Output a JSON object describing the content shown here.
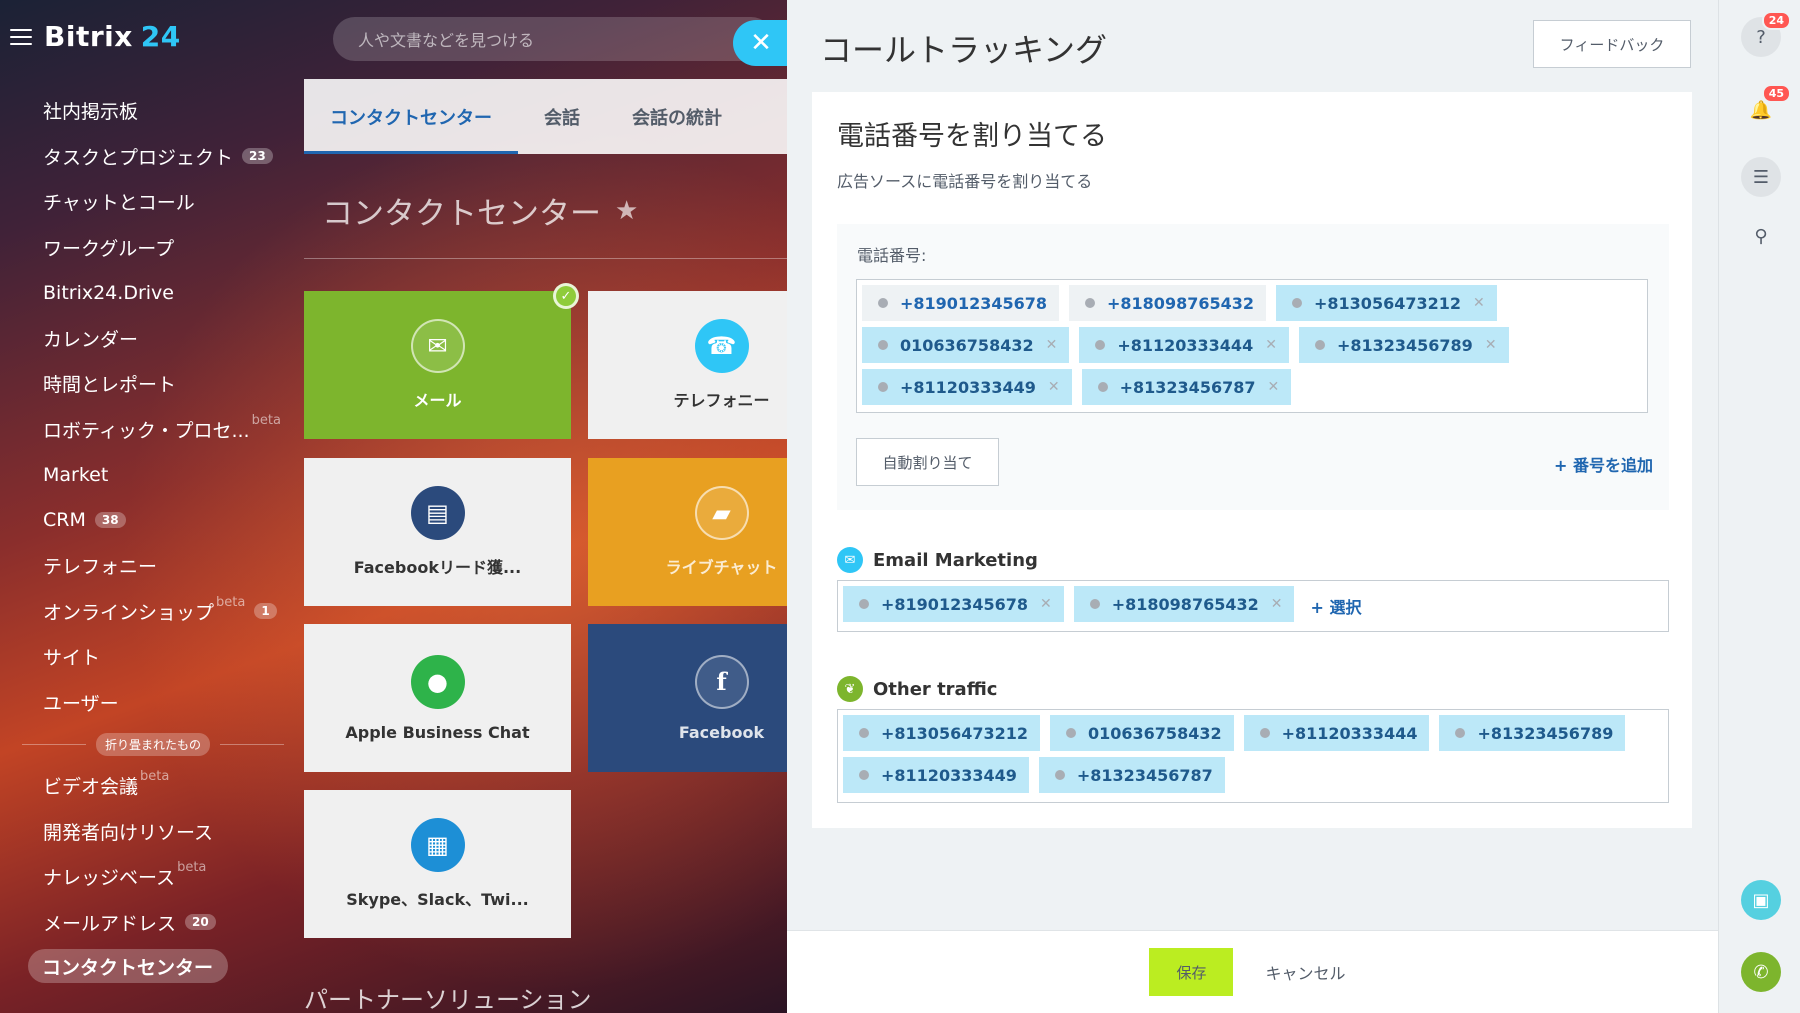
{
  "app": {
    "logo_text": "Bitrix",
    "logo_num": "24"
  },
  "search": {
    "placeholder": "人や文書などを見つける"
  },
  "sidebar": {
    "items": [
      {
        "label": "社内掲示板"
      },
      {
        "label": "タスクとプロジェクト",
        "count": "23"
      },
      {
        "label": "チャットとコール"
      },
      {
        "label": "ワークグループ"
      },
      {
        "label": "Bitrix24.Drive"
      },
      {
        "label": "カレンダー"
      },
      {
        "label": "時間とレポート"
      },
      {
        "label": "ロボティック・プロセ...",
        "beta": "beta"
      },
      {
        "label": "Market"
      },
      {
        "label": "CRM",
        "count": "38"
      },
      {
        "label": "テレフォニー"
      },
      {
        "label": "オンラインショップ",
        "beta": "beta",
        "count": "1"
      },
      {
        "label": "サイト"
      },
      {
        "label": "ユーザー"
      }
    ],
    "collapsed_label": "折り畳まれたもの",
    "collapsed_items": [
      {
        "label": "ビデオ会議",
        "beta": "beta"
      },
      {
        "label": "開発者向けリソース"
      },
      {
        "label": "ナレッジベース",
        "beta": "beta"
      },
      {
        "label": "メールアドレス",
        "count": "20"
      }
    ],
    "active_item": "コンタクトセンター"
  },
  "contact_center": {
    "tabs": [
      "コンタクトセンター",
      "会話",
      "会話の統計"
    ],
    "title": "コンタクトセンター",
    "tiles": [
      {
        "label": "メール"
      },
      {
        "label": "テレフォニー"
      },
      {
        "label": "Facebookリード獲..."
      },
      {
        "label": "ライブチャット"
      },
      {
        "label": "Apple Business Chat"
      },
      {
        "label": "Facebook",
        "glyph": "f"
      },
      {
        "label": "Skype、Slack、Twi..."
      }
    ],
    "partner_heading": "パートナーソリューション"
  },
  "panel": {
    "title": "コールトラッキング",
    "feedback": "フィードバック",
    "card_title": "電話番号を割り当てる",
    "card_subtitle": "広告ソースに電話番号を割り当てる",
    "phone_label": "電話番号:",
    "phones": [
      {
        "number": "+819012345678",
        "style": "gray",
        "removable": false
      },
      {
        "number": "+818098765432",
        "style": "gray",
        "removable": false
      },
      {
        "number": "+813056473212",
        "style": "blue",
        "removable": true
      },
      {
        "number": "010636758432",
        "style": "blue",
        "removable": true
      },
      {
        "number": "+81120333444",
        "style": "blue",
        "removable": true
      },
      {
        "number": "+81323456789",
        "style": "blue",
        "removable": true
      },
      {
        "number": "+81120333449",
        "style": "blue",
        "removable": true
      },
      {
        "number": "+81323456787",
        "style": "blue",
        "removable": true
      }
    ],
    "auto_assign": "自動割り当て",
    "add_number": "+ 番号を追加",
    "sources": [
      {
        "name": "Email Marketing",
        "color": "#2fc6f6",
        "numbers": [
          "+819012345678",
          "+818098765432"
        ],
        "removable": true,
        "select_label": "+ 選択"
      },
      {
        "name": "Other traffic",
        "color": "#7db52d",
        "numbers": [
          "+813056473212",
          "010636758432",
          "+81120333444",
          "+81323456789",
          "+81120333449",
          "+81323456787"
        ],
        "removable": false
      }
    ],
    "save": "保存",
    "cancel": "キャンセル"
  },
  "rightbar": {
    "help_badge": "24",
    "notif_badge": "45"
  },
  "colors": {
    "accent": "#2fc6f6",
    "link": "#2066b0",
    "save": "#bbed21",
    "chip": "#bce8f8"
  }
}
